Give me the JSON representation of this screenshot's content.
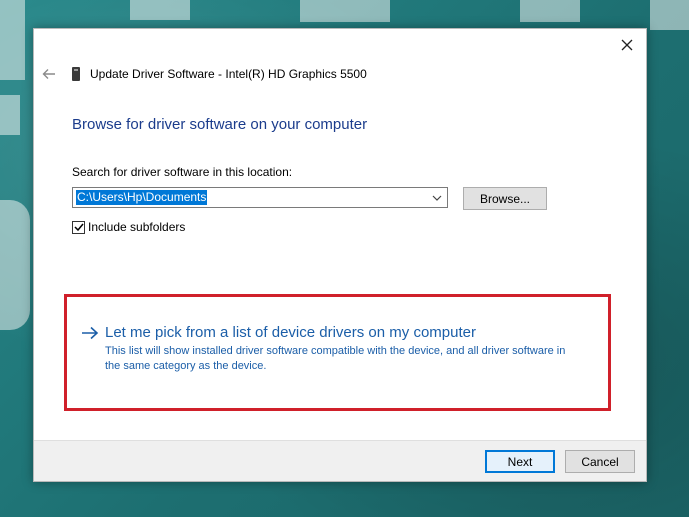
{
  "dialog": {
    "title": "Update Driver Software - Intel(R) HD Graphics 5500",
    "heading": "Browse for driver software on your computer",
    "search_label": "Search for driver software in this location:",
    "path_value": "C:\\Users\\Hp\\Documents",
    "browse_label": "Browse...",
    "include_subfolders_label": "Include subfolders",
    "include_subfolders_checked": true,
    "pick_title": "Let me pick from a list of device drivers on my computer",
    "pick_description": "This list will show installed driver software compatible with the device, and all driver software in the same category as the device.",
    "next_label": "Next",
    "cancel_label": "Cancel"
  },
  "colors": {
    "highlight": "#d0202a",
    "link": "#1b5ea8",
    "heading": "#1b3c8c",
    "wallpaper": "#1f7a7c"
  },
  "icons": {
    "close": "close-icon",
    "back": "back-arrow-icon",
    "device": "device-icon",
    "dropdown": "chevron-down-icon",
    "check": "checkmark-icon",
    "link_arrow": "right-arrow-icon"
  }
}
